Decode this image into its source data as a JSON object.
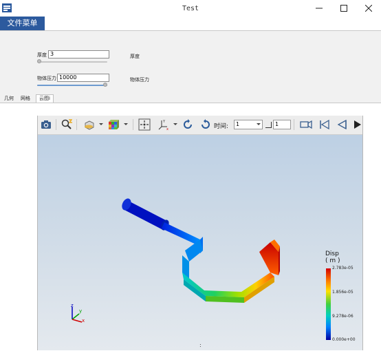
{
  "window": {
    "title": "Test"
  },
  "menu": {
    "file_label": "文件菜单"
  },
  "params": {
    "thickness": {
      "label": "厚度",
      "value": "3",
      "side_label": "厚度",
      "level": 0.0
    },
    "pressure": {
      "label": "物体压力",
      "value": "10000",
      "side_label": "物体压力",
      "level": 1.0
    }
  },
  "tabs": [
    {
      "label": "几何",
      "active": false
    },
    {
      "label": "网格",
      "active": false
    },
    {
      "label": "云图i",
      "active": true
    }
  ],
  "toolbar": {
    "time_label": "时间:",
    "time_value": "1",
    "step_value": "1",
    "icons": [
      "camera-icon",
      "probe-icon",
      "clip-plane-icon",
      "color-cube-icon",
      "fit-view-icon",
      "axes-icon",
      "rotate-left-icon",
      "rotate-right-icon",
      "video-icon",
      "first-frame-icon",
      "prev-frame-icon",
      "next-frame-icon"
    ]
  },
  "legend": {
    "title": "Disp",
    "unit": "( m )",
    "max": "2.783e-05",
    "mid1": "1.856e-05",
    "mid2": "9.278e-06",
    "min": "0.000e+00"
  },
  "status": {
    "dot": ":"
  },
  "colors": {
    "accent": "#2c5a9e",
    "slider_fill": "#6e9bd0"
  }
}
